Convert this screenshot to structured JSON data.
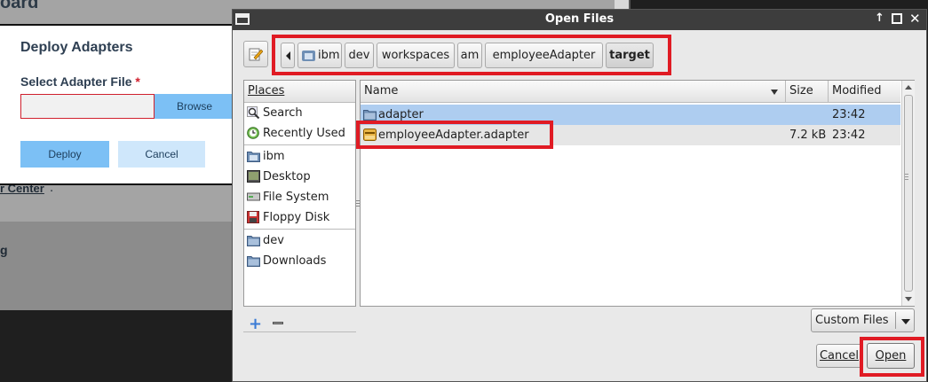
{
  "background": {
    "heading_fragment": "oard",
    "link_fragment": "r Center",
    "link_suffix": ".",
    "section_fragment": "g"
  },
  "deploy_dialog": {
    "title": "Deploy Adapters",
    "file_label": "Select Adapter File",
    "required_mark": "*",
    "file_value": "",
    "browse_label": "Browse",
    "deploy_label": "Deploy",
    "cancel_label": "Cancel"
  },
  "open_dialog": {
    "title": "Open Files",
    "breadcrumbs": [
      "ibm",
      "dev",
      "workspaces",
      "am",
      "employeeAdapter",
      "target"
    ],
    "places_header": "Places",
    "places": [
      {
        "label": "Search",
        "icon": "search-icon"
      },
      {
        "label": "Recently Used",
        "icon": "recent-icon"
      },
      {
        "label": "ibm",
        "icon": "home-folder-icon"
      },
      {
        "label": "Desktop",
        "icon": "desktop-icon"
      },
      {
        "label": "File System",
        "icon": "filesystem-icon"
      },
      {
        "label": "Floppy Disk",
        "icon": "floppy-icon"
      },
      {
        "label": "dev",
        "icon": "folder-icon"
      },
      {
        "label": "Downloads",
        "icon": "folder-icon"
      }
    ],
    "columns": {
      "name": "Name",
      "size": "Size",
      "modified": "Modified"
    },
    "files": [
      {
        "name": "adapter",
        "size": "",
        "modified": "23:42",
        "icon": "folder-icon"
      },
      {
        "name": "employeeAdapter.adapter",
        "size": "7.2 kB",
        "modified": "23:42",
        "icon": "archive-icon"
      }
    ],
    "filter": "Custom Files",
    "cancel_label": "Cancel",
    "open_label": "Open",
    "title_buttons": {
      "up": "↑",
      "close": "✕"
    },
    "colors": {
      "highlight_red": "#e01b24",
      "selection_blue": "#aecdf0"
    }
  }
}
